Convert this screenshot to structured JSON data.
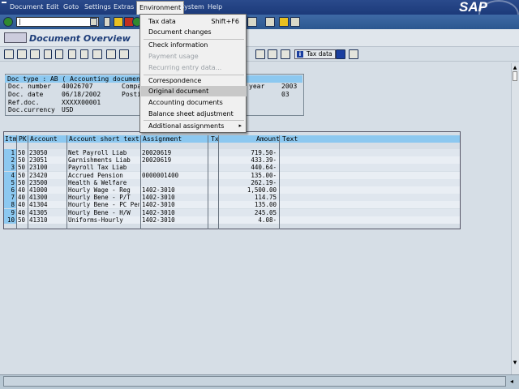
{
  "menubar": {
    "items": [
      "Document",
      "Edit",
      "Goto",
      "Settings",
      "Extras",
      "Environment",
      "System",
      "Help"
    ],
    "logo": "SAP"
  },
  "title": "Document Overview",
  "app_toolbar": {
    "tax_data_label": "Tax data"
  },
  "header": {
    "doc_type_line": "Doc type : AB ( Accounting document )",
    "labels": {
      "doc_number": "Doc. number",
      "doc_date": "Doc. date",
      "ref_doc": "Ref.doc.",
      "currency": "Doc.currency",
      "company": "Compa",
      "posting": "Posti",
      "year": "year"
    },
    "values": {
      "doc_number": "40026707",
      "doc_date": "06/18/2002",
      "ref_doc": "XXXXX00001",
      "currency": "USD",
      "year": "2003",
      "period": "03"
    }
  },
  "table": {
    "columns": [
      "Itm",
      "PK",
      "Account",
      "Account short text",
      "Assignment",
      "Tx",
      "Amount",
      "Text"
    ],
    "rows": [
      {
        "itm": "1",
        "pk": "50",
        "account": "23050",
        "short_text": "Net Payroll Liab",
        "assignment": "20020619",
        "tx": "",
        "amount": "719.50-",
        "text": ""
      },
      {
        "itm": "2",
        "pk": "50",
        "account": "23051",
        "short_text": "Garnishments Liab",
        "assignment": "20020619",
        "tx": "",
        "amount": "433.39-",
        "text": ""
      },
      {
        "itm": "3",
        "pk": "50",
        "account": "23100",
        "short_text": "Payroll Tax Liab",
        "assignment": "",
        "tx": "",
        "amount": "440.64-",
        "text": ""
      },
      {
        "itm": "4",
        "pk": "50",
        "account": "23420",
        "short_text": "Accrued Pension",
        "assignment": "0000001400",
        "tx": "",
        "amount": "135.00-",
        "text": ""
      },
      {
        "itm": "5",
        "pk": "50",
        "account": "23500",
        "short_text": "Health & Welfare",
        "assignment": "",
        "tx": "",
        "amount": "262.19-",
        "text": ""
      },
      {
        "itm": "6",
        "pk": "40",
        "account": "41000",
        "short_text": "Hourly Wage - Reg",
        "assignment": "1402-3010",
        "tx": "",
        "amount": "1,500.00",
        "text": ""
      },
      {
        "itm": "7",
        "pk": "40",
        "account": "41300",
        "short_text": "Hourly Bene - P/T",
        "assignment": "1402-3010",
        "tx": "",
        "amount": "114.75",
        "text": ""
      },
      {
        "itm": "8",
        "pk": "40",
        "account": "41304",
        "short_text": "Hourly Bene - PC Pen",
        "assignment": "1402-3010",
        "tx": "",
        "amount": "135.00",
        "text": ""
      },
      {
        "itm": "9",
        "pk": "40",
        "account": "41305",
        "short_text": "Hourly Bene - H/W",
        "assignment": "1402-3010",
        "tx": "",
        "amount": "245.05",
        "text": ""
      },
      {
        "itm": "10",
        "pk": "50",
        "account": "41310",
        "short_text": "Uniforms-Hourly",
        "assignment": "1402-3010",
        "tx": "",
        "amount": "4.08-",
        "text": ""
      }
    ]
  },
  "environment_menu": {
    "items": [
      {
        "label": "Tax data",
        "shortcut": "Shift+F6",
        "enabled": true
      },
      {
        "label": "Document changes",
        "enabled": true
      },
      {
        "label": "Check information",
        "enabled": true
      },
      {
        "label": "Payment usage",
        "enabled": false
      },
      {
        "label": "Recurring entry data...",
        "enabled": false
      },
      {
        "label": "Correspondence",
        "enabled": true
      },
      {
        "label": "Original document",
        "enabled": true,
        "highlighted": true
      },
      {
        "label": "Accounting documents",
        "enabled": true
      },
      {
        "label": "Balance sheet adjustment",
        "enabled": true
      },
      {
        "label": "Additional assignments",
        "enabled": true,
        "submenu": true
      }
    ]
  },
  "colors": {
    "menubar": "#1c3a7a",
    "highlight_blue": "#8cc8f0",
    "background": "#d6dee6"
  }
}
